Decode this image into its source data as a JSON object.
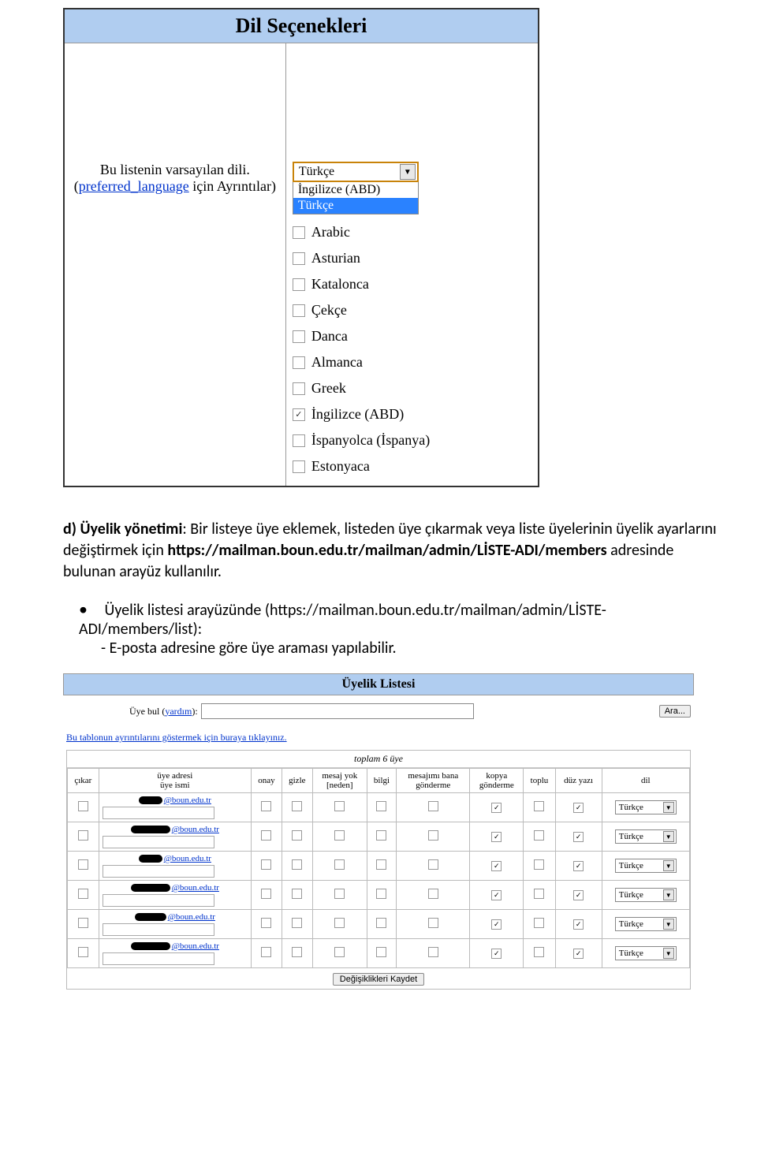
{
  "lang_panel": {
    "title": "Dil Seçenekleri",
    "default_label_line1": "Bu listenin varsayılan dili.",
    "details_link_text": "preferred_language",
    "details_suffix": " için Ayrıntılar)",
    "dropdown_selected": "Türkçe",
    "dropdown_options": [
      "İngilizce (ABD)",
      "Türkçe"
    ],
    "languages": [
      {
        "label": "Arabic",
        "checked": false
      },
      {
        "label": "Asturian",
        "checked": false
      },
      {
        "label": "Katalonca",
        "checked": false
      },
      {
        "label": "Çekçe",
        "checked": false
      },
      {
        "label": "Danca",
        "checked": false
      },
      {
        "label": "Almanca",
        "checked": false
      },
      {
        "label": "Greek",
        "checked": false
      },
      {
        "label": "İngilizce (ABD)",
        "checked": true
      },
      {
        "label": "İspanyolca (İspanya)",
        "checked": false
      },
      {
        "label": "Estonyaca",
        "checked": false
      }
    ]
  },
  "section_d": {
    "title_bold": "d) Üyelik yönetimi",
    "body1": ": Bir listeye üye eklemek, listeden üye çıkarmak veya liste üyelerinin üyelik ayarlarını değiştirmek için ",
    "url1": "https://mailman.boun.edu.tr/mailman/admin/LİSTE-ADI/members",
    "body2": " adresinde bulunan arayüz kullanılır.",
    "bullet_prefix": "Üyelik listesi arayüzünde (",
    "bullet_url": "https://mailman.boun.edu.tr/mailman/admin/LİSTE-ADI/members/list",
    "bullet_suffix": "):",
    "bullet_line2": "- E-posta adresine göre üye araması yapılabilir."
  },
  "members": {
    "header": "Üyelik Listesi",
    "search_label_pre": "Üye bul (",
    "search_help": "yardım",
    "search_label_post": "):",
    "search_button": "Ara...",
    "legend": "Bu tablonun ayrıntılarını göstermek için buraya tıklayınız.",
    "table_title": "toplam 6 üye",
    "columns": [
      "çıkar",
      "üye adresi\nüye ismi",
      "onay",
      "gizle",
      "mesaj yok\n[neden]",
      "bilgi",
      "mesajımı bana\ngönderme",
      "kopya\ngönderme",
      "toplu",
      "düz yazı",
      "dil"
    ],
    "row_defaults": {
      "domain": "@boun.edu.tr",
      "lang": "Türkçe",
      "checks": [
        false,
        false,
        false,
        false,
        false,
        false,
        true,
        false,
        true
      ]
    },
    "rows": [
      {
        "redact_w": 30
      },
      {
        "redact_w": 50
      },
      {
        "redact_w": 30
      },
      {
        "redact_w": 50
      },
      {
        "redact_w": 40
      },
      {
        "redact_w": 50
      }
    ],
    "save_button": "Değişiklikleri Kaydet"
  }
}
